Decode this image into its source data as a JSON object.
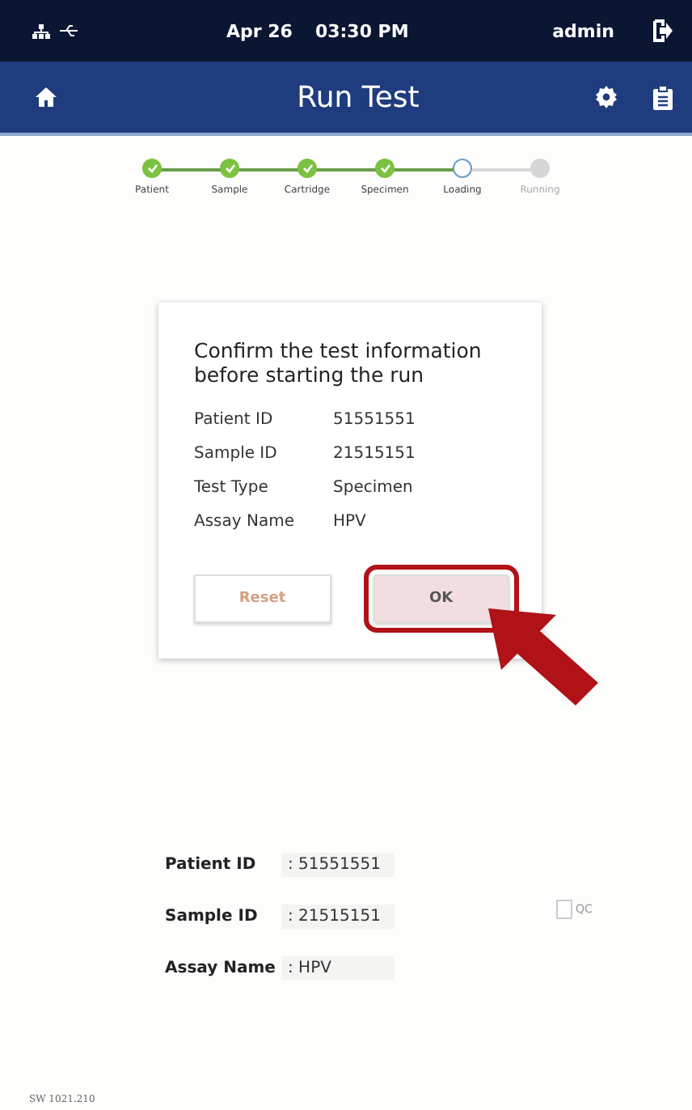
{
  "status_bar": {
    "date": "Apr 26",
    "time": "03:30 PM",
    "user": "admin"
  },
  "header": {
    "title": "Run Test"
  },
  "steps": [
    {
      "label": "Patient",
      "kind": "done"
    },
    {
      "label": "Sample",
      "kind": "done"
    },
    {
      "label": "Cartridge",
      "kind": "done"
    },
    {
      "label": "Specimen",
      "kind": "done"
    },
    {
      "label": "Loading",
      "kind": "current"
    },
    {
      "label": "Running",
      "kind": "pending"
    }
  ],
  "dialog": {
    "title": "Confirm the test information before starting the run",
    "fields": [
      {
        "label": "Patient ID",
        "value": "51551551"
      },
      {
        "label": "Sample ID",
        "value": "21515151"
      },
      {
        "label": "Test Type",
        "value": "Specimen"
      },
      {
        "label": "Assay Name",
        "value": "HPV"
      }
    ],
    "buttons": [
      {
        "label": "Reset",
        "kind": "secondary",
        "highlighted": false
      },
      {
        "label": "OK",
        "kind": "primary",
        "highlighted": true
      }
    ]
  },
  "summary": [
    {
      "label": "Patient ID",
      "value": ": 51551551"
    },
    {
      "label": "Sample ID",
      "value": ": 21515151"
    },
    {
      "label": "Assay Name",
      "value": ": HPV"
    }
  ],
  "qc": {
    "label": "QC",
    "checked": false
  },
  "footer": {
    "version": "SW 1021.210"
  }
}
